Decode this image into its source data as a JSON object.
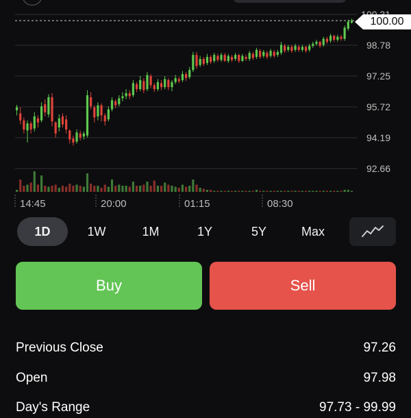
{
  "current_price_label": "100.00",
  "chart_data": {
    "type": "candlestick",
    "y_axis_ticks": [
      "100.31",
      "98.78",
      "97.25",
      "95.72",
      "94.19",
      "92.66"
    ],
    "y_range": [
      92.66,
      100.31
    ],
    "x_axis_ticks": [
      "14:45",
      "20:00",
      "01:15",
      "08:30"
    ],
    "current_price": 100.0,
    "colors": {
      "up": "#5fc94f",
      "down": "#e0443a",
      "grid": "#2e2f33",
      "axis_text": "#bdbdbd"
    },
    "candles": [
      {
        "o": 95.55,
        "c": 95.7,
        "h": 95.82,
        "l": 95.3,
        "v": 0.1
      },
      {
        "o": 95.4,
        "c": 95.05,
        "h": 95.7,
        "l": 94.85,
        "v": 0.6
      },
      {
        "o": 95.05,
        "c": 94.6,
        "h": 95.2,
        "l": 94.4,
        "v": 0.3
      },
      {
        "o": 94.55,
        "c": 94.9,
        "h": 95.05,
        "l": 93.95,
        "v": 0.35
      },
      {
        "o": 94.9,
        "c": 94.6,
        "h": 95.0,
        "l": 94.4,
        "v": 0.45
      },
      {
        "o": 94.65,
        "c": 95.25,
        "h": 95.45,
        "l": 94.5,
        "v": 1.0
      },
      {
        "o": 95.15,
        "c": 94.95,
        "h": 95.3,
        "l": 94.7,
        "v": 0.35
      },
      {
        "o": 95.05,
        "c": 95.75,
        "h": 95.95,
        "l": 94.95,
        "v": 0.8
      },
      {
        "o": 95.85,
        "c": 95.45,
        "h": 96.1,
        "l": 95.25,
        "v": 0.3
      },
      {
        "o": 95.35,
        "c": 96.2,
        "h": 96.35,
        "l": 95.2,
        "v": 0.25
      },
      {
        "o": 96.2,
        "c": 95.0,
        "h": 96.4,
        "l": 94.75,
        "v": 0.3
      },
      {
        "o": 94.95,
        "c": 94.4,
        "h": 95.0,
        "l": 94.2,
        "v": 0.35
      },
      {
        "o": 94.7,
        "c": 95.15,
        "h": 95.35,
        "l": 94.5,
        "v": 0.2
      },
      {
        "o": 95.25,
        "c": 94.85,
        "h": 95.4,
        "l": 94.7,
        "v": 0.3
      },
      {
        "o": 95.1,
        "c": 94.6,
        "h": 95.3,
        "l": 94.4,
        "v": 0.25
      },
      {
        "o": 94.55,
        "c": 94.1,
        "h": 94.6,
        "l": 93.9,
        "v": 0.4
      },
      {
        "o": 94.15,
        "c": 93.95,
        "h": 94.3,
        "l": 93.8,
        "v": 0.3
      },
      {
        "o": 94.0,
        "c": 94.45,
        "h": 94.6,
        "l": 93.9,
        "v": 0.35
      },
      {
        "o": 94.4,
        "c": 94.2,
        "h": 94.55,
        "l": 94.05,
        "v": 0.3
      },
      {
        "o": 94.25,
        "c": 94.4,
        "h": 94.5,
        "l": 94.1,
        "v": 0.25
      },
      {
        "o": 94.3,
        "c": 96.3,
        "h": 96.55,
        "l": 94.2,
        "v": 0.9
      },
      {
        "o": 96.2,
        "c": 95.75,
        "h": 96.45,
        "l": 95.6,
        "v": 0.4
      },
      {
        "o": 95.7,
        "c": 95.2,
        "h": 95.8,
        "l": 94.95,
        "v": 0.3
      },
      {
        "o": 95.25,
        "c": 95.8,
        "h": 95.95,
        "l": 95.05,
        "v": 0.3
      },
      {
        "o": 95.8,
        "c": 95.3,
        "h": 95.9,
        "l": 95.0,
        "v": 0.2
      },
      {
        "o": 95.3,
        "c": 95.0,
        "h": 95.4,
        "l": 94.8,
        "v": 0.35
      },
      {
        "o": 95.1,
        "c": 95.6,
        "h": 95.75,
        "l": 95.0,
        "v": 0.25
      },
      {
        "o": 95.6,
        "c": 96.05,
        "h": 96.2,
        "l": 95.5,
        "v": 0.6
      },
      {
        "o": 96.0,
        "c": 95.8,
        "h": 96.1,
        "l": 95.65,
        "v": 0.3
      },
      {
        "o": 95.85,
        "c": 96.15,
        "h": 96.3,
        "l": 95.75,
        "v": 0.35
      },
      {
        "o": 96.15,
        "c": 96.25,
        "h": 96.45,
        "l": 96.0,
        "v": 0.3
      },
      {
        "o": 96.25,
        "c": 96.4,
        "h": 96.6,
        "l": 96.1,
        "v": 0.3
      },
      {
        "o": 96.4,
        "c": 96.25,
        "h": 96.55,
        "l": 96.1,
        "v": 0.25
      },
      {
        "o": 96.3,
        "c": 96.9,
        "h": 97.05,
        "l": 96.2,
        "v": 0.5
      },
      {
        "o": 96.85,
        "c": 96.6,
        "h": 96.95,
        "l": 96.45,
        "v": 0.3
      },
      {
        "o": 96.6,
        "c": 97.05,
        "h": 97.25,
        "l": 96.5,
        "v": 0.3
      },
      {
        "o": 97.0,
        "c": 96.55,
        "h": 97.15,
        "l": 96.4,
        "v": 0.35
      },
      {
        "o": 96.6,
        "c": 97.3,
        "h": 97.45,
        "l": 96.5,
        "v": 0.5
      },
      {
        "o": 97.25,
        "c": 96.8,
        "h": 97.35,
        "l": 96.65,
        "v": 0.3
      },
      {
        "o": 96.8,
        "c": 96.6,
        "h": 96.9,
        "l": 96.45,
        "v": 0.55
      },
      {
        "o": 96.6,
        "c": 96.95,
        "h": 97.1,
        "l": 96.5,
        "v": 0.3
      },
      {
        "o": 96.9,
        "c": 96.7,
        "h": 97.05,
        "l": 96.55,
        "v": 0.3
      },
      {
        "o": 96.7,
        "c": 97.1,
        "h": 97.25,
        "l": 96.6,
        "v": 0.45
      },
      {
        "o": 97.05,
        "c": 96.7,
        "h": 97.15,
        "l": 96.55,
        "v": 0.35
      },
      {
        "o": 96.7,
        "c": 96.95,
        "h": 97.05,
        "l": 96.5,
        "v": 0.3
      },
      {
        "o": 96.95,
        "c": 97.15,
        "h": 97.3,
        "l": 96.85,
        "v": 0.25
      },
      {
        "o": 97.1,
        "c": 97.0,
        "h": 97.2,
        "l": 96.9,
        "v": 0.2
      },
      {
        "o": 97.05,
        "c": 97.35,
        "h": 97.5,
        "l": 96.95,
        "v": 0.35
      },
      {
        "o": 97.35,
        "c": 97.15,
        "h": 97.45,
        "l": 97.0,
        "v": 0.25
      },
      {
        "o": 97.2,
        "c": 97.55,
        "h": 97.7,
        "l": 97.1,
        "v": 0.3
      },
      {
        "o": 97.55,
        "c": 98.3,
        "h": 98.45,
        "l": 97.45,
        "v": 0.6
      },
      {
        "o": 98.3,
        "c": 97.75,
        "h": 98.45,
        "l": 97.6,
        "v": 0.35
      },
      {
        "o": 97.8,
        "c": 98.1,
        "h": 98.25,
        "l": 97.7,
        "v": 0.2
      },
      {
        "o": 98.1,
        "c": 97.85,
        "h": 98.2,
        "l": 97.75,
        "v": 0.15
      },
      {
        "o": 97.9,
        "c": 98.2,
        "h": 98.35,
        "l": 97.8,
        "v": 0.1
      },
      {
        "o": 98.2,
        "c": 97.95,
        "h": 98.3,
        "l": 97.85,
        "v": 0.1
      },
      {
        "o": 98.0,
        "c": 98.3,
        "h": 98.4,
        "l": 97.9,
        "v": 0.05
      },
      {
        "o": 98.25,
        "c": 98.05,
        "h": 98.35,
        "l": 97.95,
        "v": 0.05
      },
      {
        "o": 98.05,
        "c": 98.3,
        "h": 98.4,
        "l": 97.95,
        "v": 0.05
      },
      {
        "o": 98.3,
        "c": 98.0,
        "h": 98.4,
        "l": 97.95,
        "v": 0.05
      },
      {
        "o": 98.0,
        "c": 98.25,
        "h": 98.35,
        "l": 97.9,
        "v": 0.05
      },
      {
        "o": 98.2,
        "c": 98.05,
        "h": 98.3,
        "l": 97.95,
        "v": 0.05
      },
      {
        "o": 98.1,
        "c": 98.3,
        "h": 98.4,
        "l": 98.0,
        "v": 0.05
      },
      {
        "o": 98.3,
        "c": 98.0,
        "h": 98.35,
        "l": 97.9,
        "v": 0.05
      },
      {
        "o": 98.0,
        "c": 98.25,
        "h": 98.35,
        "l": 97.95,
        "v": 0.05
      },
      {
        "o": 98.2,
        "c": 98.1,
        "h": 98.3,
        "l": 98.0,
        "v": 0.05
      },
      {
        "o": 98.1,
        "c": 98.4,
        "h": 98.5,
        "l": 98.0,
        "v": 0.05
      },
      {
        "o": 98.35,
        "c": 98.15,
        "h": 98.45,
        "l": 98.05,
        "v": 0.05
      },
      {
        "o": 98.2,
        "c": 98.55,
        "h": 98.65,
        "l": 98.1,
        "v": 0.1
      },
      {
        "o": 98.5,
        "c": 98.2,
        "h": 98.6,
        "l": 98.1,
        "v": 0.05
      },
      {
        "o": 98.25,
        "c": 98.45,
        "h": 98.55,
        "l": 98.15,
        "v": 0.05
      },
      {
        "o": 98.4,
        "c": 98.2,
        "h": 98.5,
        "l": 98.1,
        "v": 0.05
      },
      {
        "o": 98.25,
        "c": 98.5,
        "h": 98.6,
        "l": 98.15,
        "v": 0.05
      },
      {
        "o": 98.45,
        "c": 98.25,
        "h": 98.55,
        "l": 98.15,
        "v": 0.05
      },
      {
        "o": 98.3,
        "c": 98.45,
        "h": 98.55,
        "l": 98.2,
        "v": 0.05
      },
      {
        "o": 98.4,
        "c": 98.8,
        "h": 98.95,
        "l": 98.3,
        "v": 0.05
      },
      {
        "o": 98.75,
        "c": 98.5,
        "h": 98.85,
        "l": 98.4,
        "v": 0.05
      },
      {
        "o": 98.55,
        "c": 98.7,
        "h": 98.8,
        "l": 98.45,
        "v": 0.05
      },
      {
        "o": 98.7,
        "c": 98.5,
        "h": 98.8,
        "l": 98.4,
        "v": 0.05
      },
      {
        "o": 98.55,
        "c": 98.75,
        "h": 98.85,
        "l": 98.45,
        "v": 0.05
      },
      {
        "o": 98.7,
        "c": 98.55,
        "h": 98.8,
        "l": 98.45,
        "v": 0.05
      },
      {
        "o": 98.55,
        "c": 98.7,
        "h": 98.8,
        "l": 98.45,
        "v": 0.05
      },
      {
        "o": 98.7,
        "c": 98.5,
        "h": 98.75,
        "l": 98.4,
        "v": 0.05
      },
      {
        "o": 98.55,
        "c": 98.75,
        "h": 98.85,
        "l": 98.45,
        "v": 0.05
      },
      {
        "o": 98.75,
        "c": 98.85,
        "h": 98.95,
        "l": 98.65,
        "v": 0.05
      },
      {
        "o": 98.85,
        "c": 98.95,
        "h": 99.05,
        "l": 98.75,
        "v": 0.05
      },
      {
        "o": 98.95,
        "c": 98.75,
        "h": 99.0,
        "l": 98.65,
        "v": 0.05
      },
      {
        "o": 98.8,
        "c": 99.1,
        "h": 99.2,
        "l": 98.7,
        "v": 0.05
      },
      {
        "o": 99.1,
        "c": 98.95,
        "h": 99.2,
        "l": 98.85,
        "v": 0.05
      },
      {
        "o": 99.0,
        "c": 99.25,
        "h": 99.35,
        "l": 98.9,
        "v": 0.05
      },
      {
        "o": 99.25,
        "c": 99.05,
        "h": 99.3,
        "l": 98.95,
        "v": 0.05
      },
      {
        "o": 99.05,
        "c": 99.2,
        "h": 99.3,
        "l": 98.95,
        "v": 0.05
      },
      {
        "o": 99.2,
        "c": 99.1,
        "h": 99.3,
        "l": 99.0,
        "v": 0.05
      },
      {
        "o": 99.1,
        "c": 99.65,
        "h": 99.75,
        "l": 99.0,
        "v": 0.1
      },
      {
        "o": 99.6,
        "c": 99.95,
        "h": 100.05,
        "l": 99.5,
        "v": 0.1
      },
      {
        "o": 99.9,
        "c": 100.0,
        "h": 100.1,
        "l": 99.85,
        "v": 0.05
      }
    ]
  },
  "range_tabs": [
    {
      "label": "1D",
      "active": true
    },
    {
      "label": "1W",
      "active": false
    },
    {
      "label": "1M",
      "active": false
    },
    {
      "label": "1Y",
      "active": false
    },
    {
      "label": "5Y",
      "active": false
    },
    {
      "label": "Max",
      "active": false
    }
  ],
  "chart_toggle_icon": "line-chart-icon",
  "actions": {
    "buy_label": "Buy",
    "sell_label": "Sell"
  },
  "stats": [
    {
      "label": "Previous Close",
      "value": "97.26"
    },
    {
      "label": "Open",
      "value": "97.98"
    },
    {
      "label": "Day's Range",
      "value": "97.73 - 99.99"
    }
  ]
}
